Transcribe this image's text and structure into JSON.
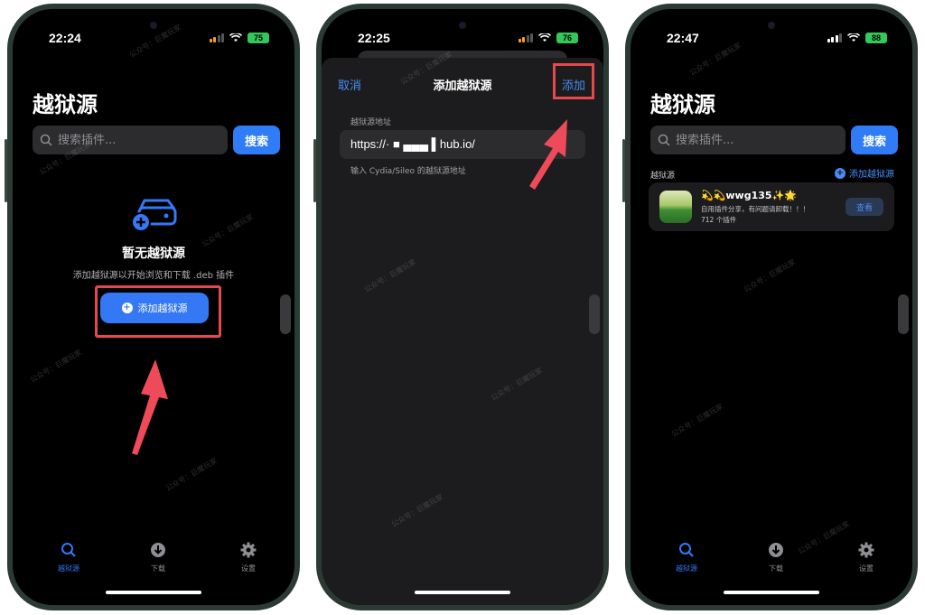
{
  "phones": [
    {
      "status": {
        "time": "22:24",
        "battery": "75"
      },
      "title": "越狱源",
      "search": {
        "placeholder": "搜索插件...",
        "button": "搜索"
      },
      "empty_state": {
        "title": "暂无越狱源",
        "subtitle": "添加越狱源以开始浏览和下载 .deb 插件",
        "add_button": "添加越狱源"
      },
      "tabs": [
        {
          "label": "越狱源",
          "icon": "search-icon"
        },
        {
          "label": "下载",
          "icon": "download-icon"
        },
        {
          "label": "设置",
          "icon": "gear-icon"
        }
      ]
    },
    {
      "status": {
        "time": "22:25",
        "battery": "76"
      },
      "nav": {
        "cancel": "取消",
        "title": "添加越狱源",
        "add": "添加"
      },
      "field_label": "越狱源地址",
      "url_value": "https://· ■  ▄▄▄  ▌hub.io/",
      "field_help": "输入 Cydia/Sileo 的越狱源地址"
    },
    {
      "status": {
        "time": "22:47",
        "battery": "88"
      },
      "title": "越狱源",
      "search": {
        "placeholder": "搜索插件...",
        "button": "搜索"
      },
      "section_label": "越狱源",
      "section_add": "添加越狱源",
      "source": {
        "name": "💫💫wwg135✨🌟",
        "description": "自用插件分享，有问题请卸载！！！",
        "count": "712 个插件",
        "view_button": "查看"
      },
      "tabs": [
        {
          "label": "越狱源",
          "icon": "search-icon"
        },
        {
          "label": "下载",
          "icon": "download-icon"
        },
        {
          "label": "设置",
          "icon": "gear-icon"
        }
      ]
    }
  ],
  "watermark": "公众号：巨魔玩家",
  "colors": {
    "accent": "#3478f6",
    "highlight": "#e5484d",
    "background": "#000000",
    "battery": "#34c759"
  }
}
